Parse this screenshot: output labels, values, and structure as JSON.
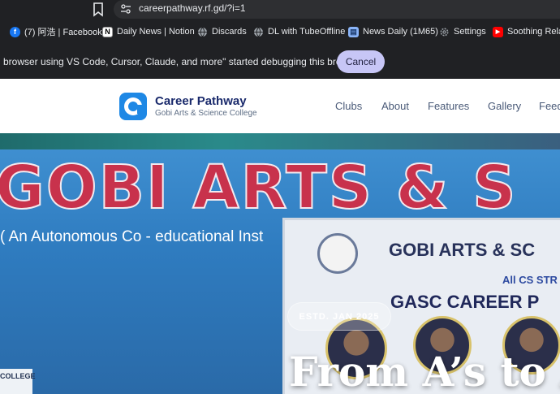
{
  "browser": {
    "url": "careerpathway.rf.gd/?i=1",
    "bookmarks": [
      {
        "label": "(7) 阿浩 | Facebook",
        "icon": "facebook-icon",
        "color": "#1877f2"
      },
      {
        "label": "Daily News | Notion",
        "icon": "notion-icon",
        "color": "#ffffff"
      },
      {
        "label": "Discards",
        "icon": "globe-icon",
        "color": "#9aa0a6"
      },
      {
        "label": "DL with TubeOffline",
        "icon": "globe-icon",
        "color": "#9aa0a6"
      },
      {
        "label": "News Daily (1M65)",
        "icon": "document-icon",
        "color": "#8ab4f8"
      },
      {
        "label": "Settings",
        "icon": "gear-icon",
        "color": "#9aa0a6"
      },
      {
        "label": "Soothing Relax",
        "icon": "youtube-icon",
        "color": "#ff0000"
      }
    ],
    "infobar": {
      "message": "browser using VS Code, Cursor, Claude, and more\" started debugging this browser",
      "cancel_label": "Cancel"
    }
  },
  "site": {
    "brand_title": "Career Pathway",
    "brand_subtitle": "Gobi Arts & Science College",
    "nav": [
      "Clubs",
      "About",
      "Features",
      "Gallery",
      "Feed"
    ],
    "accent": "#1a2a6c"
  },
  "hero": {
    "banner_title": "GOBI ARTS & S",
    "banner_subtitle": "( An Autonomous Co - educational Inst",
    "poster_title": "GOBI ARTS & SC",
    "poster_line2": "All CS STR",
    "poster_line3": "GASC CAREER P",
    "badge": "ESTD. JAN 2025",
    "heading": "From A’s to Ac",
    "podium_text": "COLLEGE"
  }
}
